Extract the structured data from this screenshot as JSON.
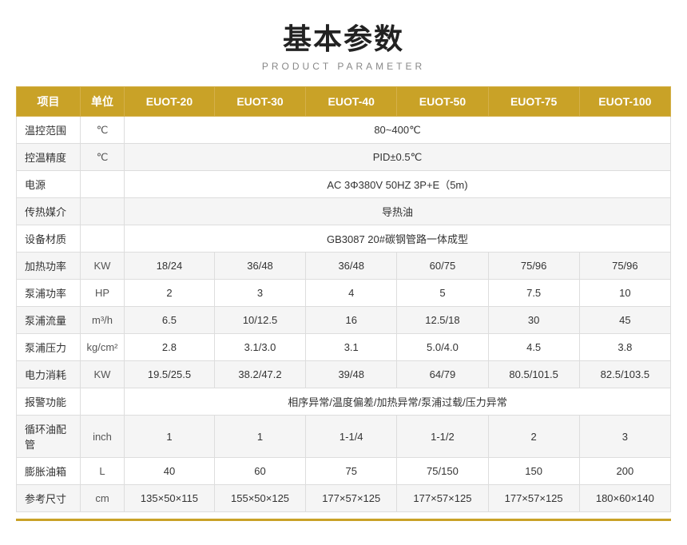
{
  "header": {
    "title": "基本参数",
    "subtitle": "PRODUCT PARAMETER"
  },
  "table": {
    "columns": [
      "项目",
      "单位",
      "EUOT-20",
      "EUOT-30",
      "EUOT-40",
      "EUOT-50",
      "EUOT-75",
      "EUOT-100"
    ],
    "rows": [
      {
        "label": "温控范围",
        "unit": "℃",
        "span": true,
        "value": "80~400℃"
      },
      {
        "label": "控温精度",
        "unit": "℃",
        "span": true,
        "value": "PID±0.5℃"
      },
      {
        "label": "电源",
        "unit": "",
        "span": true,
        "value": "AC 3Φ380V 50HZ 3P+E（5m)"
      },
      {
        "label": "传热媒介",
        "unit": "",
        "span": true,
        "value": "导热油"
      },
      {
        "label": "设备材质",
        "unit": "",
        "span": true,
        "value": "GB3087    20#碳钢管路一体成型"
      },
      {
        "label": "加热功率",
        "unit": "KW",
        "span": false,
        "values": [
          "18/24",
          "36/48",
          "36/48",
          "60/75",
          "75/96",
          "75/96"
        ]
      },
      {
        "label": "泵浦功率",
        "unit": "HP",
        "span": false,
        "values": [
          "2",
          "3",
          "4",
          "5",
          "7.5",
          "10"
        ]
      },
      {
        "label": "泵浦流量",
        "unit": "m³/h",
        "span": false,
        "values": [
          "6.5",
          "10/12.5",
          "16",
          "12.5/18",
          "30",
          "45"
        ]
      },
      {
        "label": "泵浦压力",
        "unit": "kg/cm²",
        "span": false,
        "values": [
          "2.8",
          "3.1/3.0",
          "3.1",
          "5.0/4.0",
          "4.5",
          "3.8"
        ]
      },
      {
        "label": "电力消耗",
        "unit": "KW",
        "span": false,
        "values": [
          "19.5/25.5",
          "38.2/47.2",
          "39/48",
          "64/79",
          "80.5/101.5",
          "82.5/103.5"
        ]
      },
      {
        "label": "报警功能",
        "unit": "",
        "span": true,
        "value": "相序异常/温度偏差/加热异常/泵浦过载/压力异常"
      },
      {
        "label": "循环油配管",
        "unit": "inch",
        "span": false,
        "values": [
          "1",
          "1",
          "1-1/4",
          "1-1/2",
          "2",
          "3"
        ]
      },
      {
        "label": "膨胀油箱",
        "unit": "L",
        "span": false,
        "values": [
          "40",
          "60",
          "75",
          "75/150",
          "150",
          "200"
        ]
      },
      {
        "label": "参考尺寸",
        "unit": "cm",
        "span": false,
        "values": [
          "135×50×115",
          "155×50×125",
          "177×57×125",
          "177×57×125",
          "177×57×125",
          "180×60×140"
        ]
      }
    ]
  }
}
